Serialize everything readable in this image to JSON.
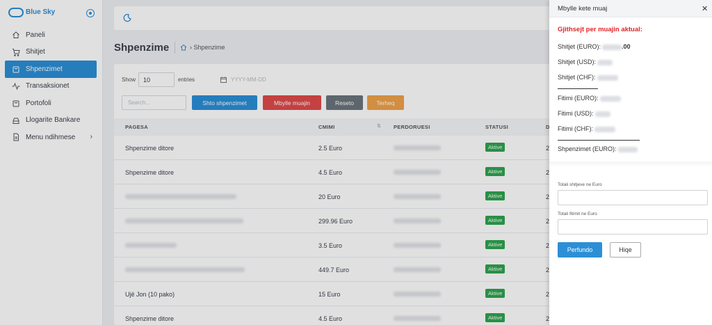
{
  "brand": {
    "name": "Blue Sky",
    "tagline": ""
  },
  "sidebar": {
    "items": [
      {
        "label": "Paneli",
        "icon": "home-icon",
        "active": false
      },
      {
        "label": "Shitjet",
        "icon": "cart-icon",
        "active": false
      },
      {
        "label": "Shpenzimet",
        "icon": "bag-icon",
        "active": true
      },
      {
        "label": "Transaksionet",
        "icon": "activity-icon",
        "active": false
      },
      {
        "label": "Portofoli",
        "icon": "wallet-icon",
        "active": false
      },
      {
        "label": "Llogarite Bankare",
        "icon": "bank-icon",
        "active": false
      },
      {
        "label": "Menu ndihmese",
        "icon": "document-icon",
        "active": false,
        "has_submenu": true
      }
    ]
  },
  "header": {
    "page_title": "Shpenzime",
    "breadcrumb": "Shpenzime"
  },
  "toolbar": {
    "show_label": "Show",
    "show_value": "10",
    "entries_label": "entries",
    "date_placeholder": "YYYY-MM-DD",
    "search_placeholder": "Search...",
    "btn_add": "Shto shpenzimet",
    "btn_close_month": "Mbylle muajin",
    "btn_reset": "Reseto",
    "btn_withdraw": "Terheq"
  },
  "table": {
    "columns": [
      "PAGESA",
      "CMIMI",
      "PERDORUESI",
      "STATUSI",
      "D"
    ],
    "rows": [
      {
        "pagesa": "Shpenzime ditore",
        "cmimi": "2.5 Euro",
        "statusi": "Aktive",
        "d": "2"
      },
      {
        "pagesa": "Shpenzime ditore",
        "cmimi": "4.5 Euro",
        "statusi": "Aktive",
        "d": "2"
      },
      {
        "pagesa": "",
        "cmimi": "20 Euro",
        "statusi": "Aktive",
        "d": "2"
      },
      {
        "pagesa": "",
        "cmimi": "299.96 Euro",
        "statusi": "Aktive",
        "d": "2"
      },
      {
        "pagesa": "",
        "cmimi": "3.5 Euro",
        "statusi": "Aktive",
        "d": "2"
      },
      {
        "pagesa": "",
        "cmimi": "449.7 Euro",
        "statusi": "Aktive",
        "d": "2"
      },
      {
        "pagesa": "Ujë Jon (10 pako)",
        "cmimi": "15 Euro",
        "statusi": "Aktive",
        "d": "2"
      },
      {
        "pagesa": "Shpenzime ditore",
        "cmimi": "4.5 Euro",
        "statusi": "Aktive",
        "d": "2"
      }
    ]
  },
  "drawer": {
    "title": "Mbylle kete muaj",
    "summary_title": "Gjithsejt per muajin aktual:",
    "shitjet_euro": "Shitjet (EURO):",
    "shitjet_euro_suffix": ".00",
    "shitjet_usd": "Shitjet (USD):",
    "shitjet_chf": "Shitjet (CHF):",
    "fitimi_euro": "Fitimi (EURO):",
    "fitimi_usd": "Fitimi (USD):",
    "fitimi_chf": "Fitimi (CHF):",
    "shpenzimet_euro": "Shpenzimet (EURO):",
    "label_total_sales": "Totali shitjeve ne Euro",
    "label_total_profit": "Totali fitimit ne Euro",
    "btn_finish": "Perfundo",
    "btn_cancel": "Hiqe"
  },
  "colors": {
    "primary": "#2c8fd6",
    "danger": "#e04b4b",
    "secondary": "#6c757d",
    "warning": "#f0a24a",
    "success": "#2ea44f",
    "summary_red": "#e02424"
  }
}
